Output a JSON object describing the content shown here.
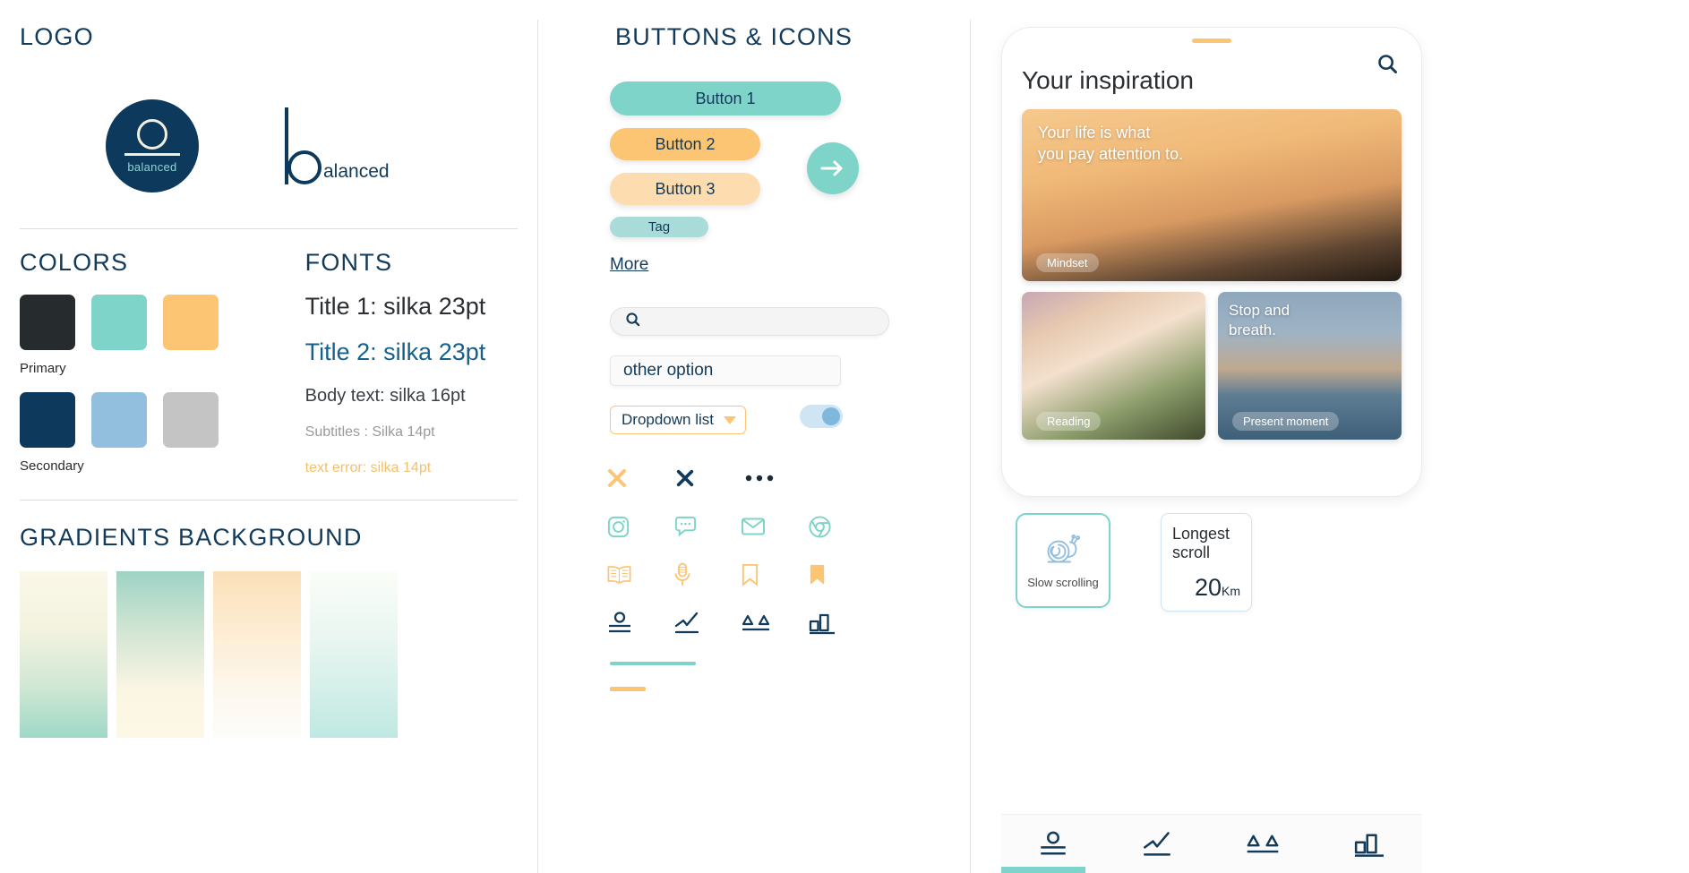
{
  "identity": {
    "section_title": "LOGO",
    "logo_mark_word": "balanced",
    "logo_wordmark_rest": "alanced"
  },
  "colors": {
    "section_title": "COLORS",
    "primary_label": "Primary",
    "secondary_label": "Secondary",
    "primary": [
      "#262b2e",
      "#7ed4c8",
      "#fbc573"
    ],
    "secondary": [
      "#0d3a5c",
      "#93bfde",
      "#c4c4c4"
    ]
  },
  "fonts": {
    "section_title": "FONTS",
    "title1": "Title 1: silka 23pt",
    "title2": "Title 2: silka 23pt",
    "body": "Body text: silka 16pt",
    "subtitle": "Subtitles : Silka 14pt",
    "error": "text error: silka 14pt",
    "title2_color": "#14618d",
    "error_color": "#f5c06a"
  },
  "gradients": {
    "section_title": "GRADIENTS BACKGROUND",
    "swatches": [
      {
        "name": "cream-to-mint",
        "from": "#fbf7e8",
        "to": "#9ed8c6"
      },
      {
        "name": "mint-to-cream",
        "from": "#9ed3c4",
        "to": "#fdf8e6"
      },
      {
        "name": "peach-to-white",
        "from": "#fbe0b8",
        "to": "#fdfdfb"
      },
      {
        "name": "white-to-aqua",
        "from": "#fbfdf8",
        "to": "#bfe8e2"
      }
    ]
  },
  "buttons": {
    "section_title": "BUTTONS & ICONS",
    "button1": "Button 1",
    "button2": "Button 2",
    "button3": "Button 3",
    "tag": "Tag",
    "more": "More",
    "arrow_icon": "arrow-right-icon"
  },
  "forms": {
    "search_placeholder": "",
    "search_icon": "search-icon",
    "other_option_value": "other option",
    "dropdown_value": "Dropdown list",
    "dropdown_caret": "chevron-down-icon",
    "toggle_state": "on"
  },
  "icons": {
    "rows": [
      [
        {
          "name": "close-x-icon",
          "color": "#fbc573"
        },
        {
          "name": "close-x-icon",
          "color": "#123a5a"
        },
        {
          "name": "ellipsis-icon",
          "color": "#1b2b38"
        }
      ],
      [
        {
          "name": "instagram-icon",
          "color": "#7ed4c8"
        },
        {
          "name": "chat-bubble-icon",
          "color": "#7ed4c8"
        },
        {
          "name": "mail-icon",
          "color": "#7ed4c8"
        },
        {
          "name": "chrome-icon",
          "color": "#7ed4c8"
        }
      ],
      [
        {
          "name": "book-icon",
          "color": "#fbc573"
        },
        {
          "name": "microphone-icon",
          "color": "#fbc573"
        },
        {
          "name": "bookmark-outline-icon",
          "color": "#fbc573"
        },
        {
          "name": "bookmark-filled-icon",
          "color": "#fbc573"
        }
      ],
      [
        {
          "name": "profile-lines-icon",
          "color": "#123a5a"
        },
        {
          "name": "chart-line-icon",
          "color": "#123a5a"
        },
        {
          "name": "balance-scale-icon",
          "color": "#123a5a"
        },
        {
          "name": "bar-chart-icon",
          "color": "#123a5a"
        }
      ]
    ]
  },
  "app": {
    "title": "Your inspiration",
    "search_icon": "search-icon",
    "hero": {
      "quote_line1": "Your life is what",
      "quote_line2": "you pay attention to.",
      "tag": "Mindset"
    },
    "cards": [
      {
        "quote": "",
        "tag": "Reading"
      },
      {
        "quote_line1": "Stop and",
        "quote_line2": "breath.",
        "tag": "Present moment"
      }
    ],
    "widgets": {
      "slow_scrolling_label": "Slow scrolling",
      "slow_scrolling_icon": "snail-icon",
      "longest_scroll_label_line1": "Longest",
      "longest_scroll_label_line2": "scroll",
      "longest_scroll_value": "20",
      "longest_scroll_unit": "Km"
    },
    "nav": [
      {
        "name": "profile-lines-icon"
      },
      {
        "name": "chart-line-icon"
      },
      {
        "name": "balance-scale-icon"
      },
      {
        "name": "bar-chart-icon"
      }
    ]
  }
}
